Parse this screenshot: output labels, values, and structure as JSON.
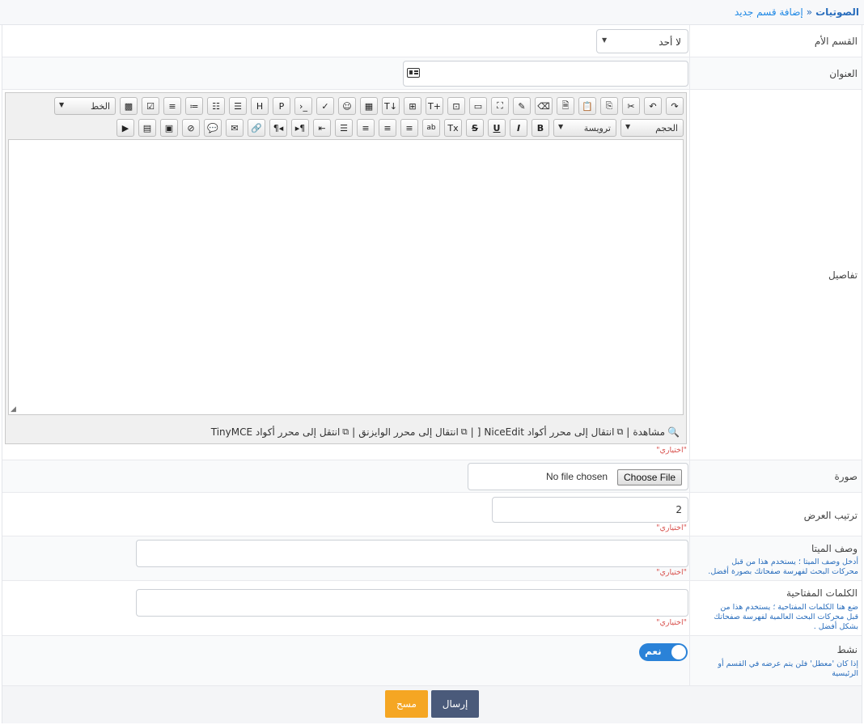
{
  "breadcrumb": {
    "root": "الصوتيات",
    "separator": "»",
    "current": "إضافة قسم جديد"
  },
  "fields": {
    "parent": {
      "label": "القسم الأم",
      "value": "لا أحد"
    },
    "title": {
      "label": "العنوان",
      "value": ""
    },
    "details": {
      "label": "تفاصيل",
      "toolbar": {
        "font_label": "الخط",
        "size_label": "الحجم",
        "heading_label": "ترويسة",
        "row1_icons": [
          "redo-icon",
          "undo-icon",
          "cut-icon",
          "copy-icon",
          "paste-icon",
          "paste-text-icon",
          "eraser-icon",
          "paste-word-icon",
          "fullscreen-icon",
          "image-icon",
          "insert-image-icon",
          "add-text-icon",
          "add-template-icon",
          "text-direction-icon",
          "template-icon",
          "emoji-icon",
          "spellcheck-icon",
          "code-icon",
          "php-icon",
          "html-icon",
          "ordered-list-icon",
          "unordered-list-icon",
          "bullet-list-icon",
          "list-icon",
          "checklist-icon",
          "qr-icon"
        ],
        "row2_icons": [
          "bold-icon",
          "italic-icon",
          "underline-icon",
          "strikethrough-icon",
          "clear-format-icon",
          "highlight-icon",
          "align-right-icon",
          "align-center-icon",
          "align-left-icon",
          "justify-icon",
          "indent-icon",
          "rtl-icon",
          "ltr-icon",
          "link-icon",
          "email-icon",
          "comment-icon",
          "unlink-icon",
          "gallery-icon",
          "image-gallery-icon",
          "video-icon"
        ]
      },
      "links": {
        "preview": "مشاهدة",
        "niceedit": "انتقال إلى محرر أكواد NiceEdit",
        "wysiwyg": "انتقال إلى محرر الوايزنق",
        "tinymce": "انتقل إلى محرر أكواد TinyMCE",
        "separator": "|",
        "bracket_open": "[",
        "bracket_close": "]"
      },
      "optional": "\"اختياري\""
    },
    "image": {
      "label": "صورة",
      "button": "Choose File",
      "status": "No file chosen"
    },
    "order": {
      "label": "ترتيب العرض",
      "value": "2",
      "optional": "\"اختياري\""
    },
    "meta": {
      "label": "وصف الميتا",
      "hint_line1": "أدخل وصف الميتا ؛ يستخدم هذا من قبل",
      "hint_line2": "محركات البحث لفهرسة صفحاتك بصورة أفضل.",
      "value": "",
      "optional": "\"اختياري\""
    },
    "keywords": {
      "label": "الكلمات المفتاحية",
      "hint_line1": "ضع هنا الكلمات المفتاحية ؛ يستخدم هذا من",
      "hint_line2": "قبل محركات البحث العالمية لفهرسة صفحاتك",
      "hint_line3": "بشكل أفضل .",
      "value": "",
      "optional": "\"اختياري\""
    },
    "active": {
      "label": "نشط",
      "hint_line1": "إذا كان 'معطل' فلن يتم عرضه في القسم أو",
      "hint_line2": "الرئيسية",
      "toggle_label": "نعم",
      "on": true
    }
  },
  "actions": {
    "submit": "إرسال",
    "clear": "مسح"
  },
  "colors": {
    "accent": "#2a82d8",
    "submit": "#4a5a7a",
    "clear": "#f5a623",
    "optional": "#d9534f"
  }
}
